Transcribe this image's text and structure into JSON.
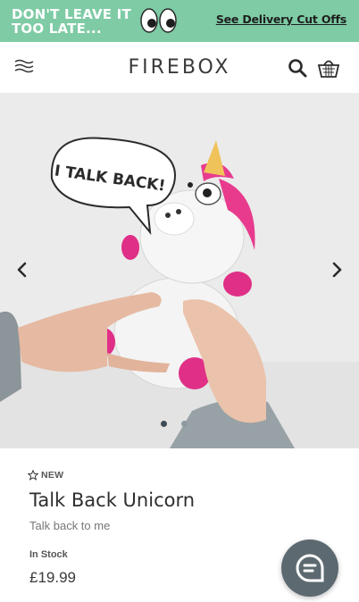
{
  "promo": {
    "headline": "DON'T LEAVE IT TOO LATE...",
    "link_label": "See Delivery Cut Offs",
    "background_color": "#7ecba5"
  },
  "header": {
    "logo": "FIREBOX",
    "icons": [
      "menu-icon",
      "search-icon",
      "basket-icon"
    ]
  },
  "gallery": {
    "speech_bubble_text": "I TALK BACK!",
    "slide_count": 2,
    "active_slide": 1,
    "icons": [
      "chevron-left-icon",
      "chevron-right-icon"
    ]
  },
  "product": {
    "badge": "NEW",
    "title": "Talk Back Unicorn",
    "subtitle": "Talk back to me",
    "stock_status": "In Stock",
    "price": "£19.99"
  },
  "chat": {
    "icon": "chat-icon",
    "color": "#5c6970"
  }
}
